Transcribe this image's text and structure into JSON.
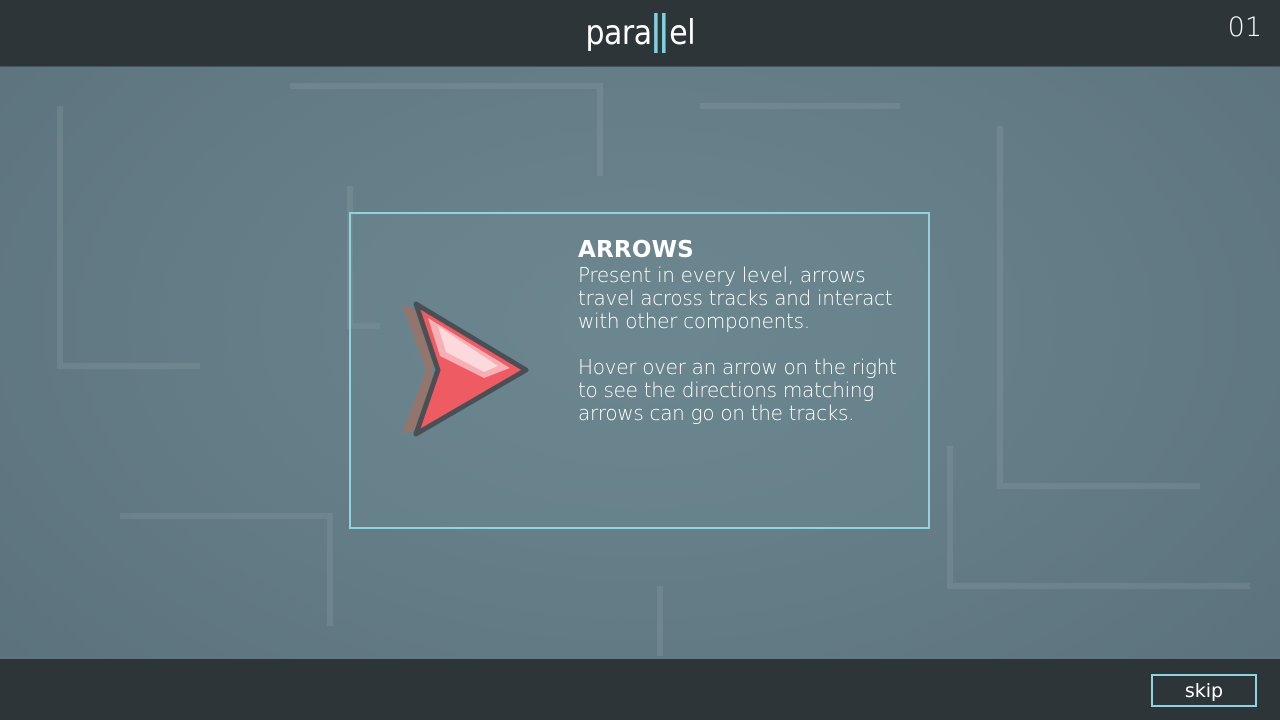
{
  "header": {
    "logo_prefix": "para",
    "logo_suffix": "el",
    "level_number": "01"
  },
  "tutorial": {
    "title": "ARROWS",
    "paragraph_1": "Present in every level, arrows travel across tracks and interact with other components.",
    "paragraph_2": "Hover over an arrow on the right to see the directions matching arrows can go on the tracks.",
    "icon": "arrow-icon"
  },
  "footer": {
    "skip_label": "skip"
  },
  "colors": {
    "bar_background": "#2e3539",
    "accent": "#8fd3de",
    "background": "#647d87",
    "arrow_red": "#ef5b63",
    "arrow_shadow": "#9a7468"
  }
}
